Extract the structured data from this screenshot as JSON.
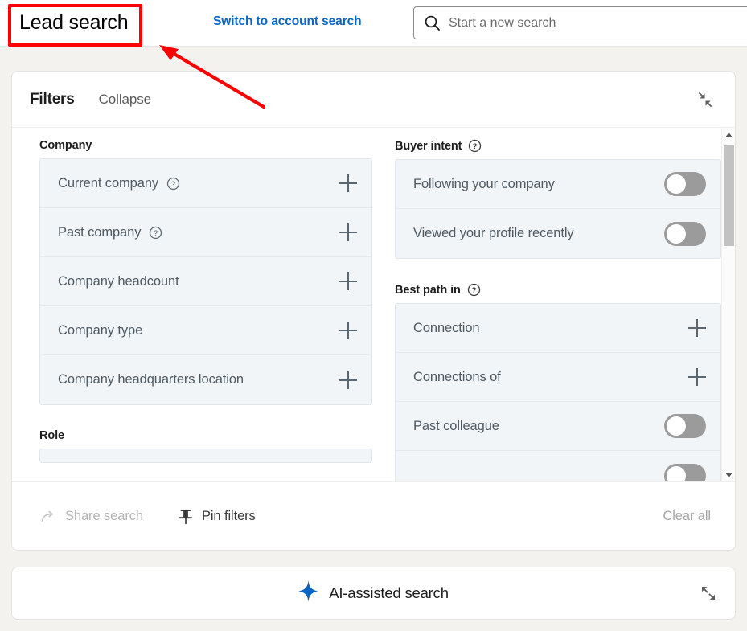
{
  "topbar": {
    "title": "Lead search",
    "switch_link": "Switch to account search",
    "search": {
      "placeholder": "Start a new search",
      "value": "",
      "icon": "search-icon"
    }
  },
  "filters_panel": {
    "heading": "Filters",
    "collapse_label": "Collapse",
    "collapse_icon": "collapse-inward-icon",
    "groups_left": [
      {
        "title": "Company",
        "has_help": false,
        "rows": [
          {
            "label": "Current company",
            "help": true,
            "control": "plus"
          },
          {
            "label": "Past company",
            "help": true,
            "control": "plus"
          },
          {
            "label": "Company headcount",
            "help": false,
            "control": "plus"
          },
          {
            "label": "Company type",
            "help": false,
            "control": "plus"
          },
          {
            "label": "Company headquarters location",
            "help": false,
            "control": "plus"
          }
        ]
      },
      {
        "title": "Role",
        "has_help": false,
        "rows": [
          {
            "label": "",
            "help": false,
            "control": "none"
          }
        ]
      }
    ],
    "groups_right": [
      {
        "title": "Buyer intent",
        "has_help": true,
        "rows": [
          {
            "label": "Following your company",
            "help": false,
            "control": "toggle",
            "on": false
          },
          {
            "label": "Viewed your profile recently",
            "help": false,
            "control": "toggle",
            "on": false
          }
        ]
      },
      {
        "title": "Best path in",
        "has_help": true,
        "rows": [
          {
            "label": "Connection",
            "help": false,
            "control": "plus"
          },
          {
            "label": "Connections of",
            "help": false,
            "control": "plus"
          },
          {
            "label": "Past colleague",
            "help": false,
            "control": "toggle",
            "on": false
          },
          {
            "label": "",
            "help": false,
            "control": "toggle",
            "on": false
          }
        ]
      }
    ],
    "scrollbar": {
      "up_arrow": "scroll-up-arrow",
      "down_arrow": "scroll-down-arrow"
    },
    "footer": {
      "share_label": "Share search",
      "share_icon": "share-arrow-icon",
      "pin_label": "Pin filters",
      "pin_icon": "pushpin-icon",
      "clear_label": "Clear all"
    }
  },
  "ai_bar": {
    "label": "AI-assisted search",
    "sparkle_icon": "sparkle-icon",
    "expand_icon": "expand-outward-icon",
    "accent_color": "#0a66c2"
  },
  "annotations": {
    "highlight_color": "#ff0000",
    "highlight_target": "Lead search",
    "arrow_icon": "annotation-arrow-icon"
  }
}
